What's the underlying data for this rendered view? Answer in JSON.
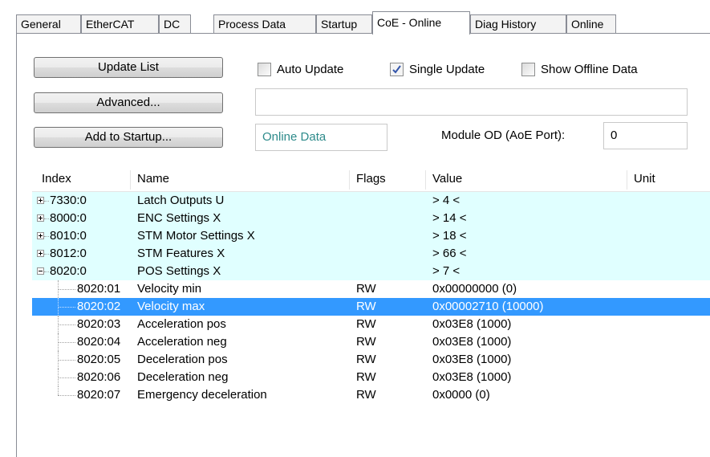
{
  "tabs": [
    "General",
    "EtherCAT",
    "DC",
    "Process Data",
    "Startup",
    "CoE - Online",
    "Diag History",
    "Online"
  ],
  "buttons": {
    "update_list": "Update List",
    "advanced": "Advanced...",
    "add_to_startup": "Add to Startup..."
  },
  "checkboxes": {
    "auto_update": {
      "label": "Auto Update",
      "checked": false
    },
    "single_update": {
      "label": "Single Update",
      "checked": true
    },
    "show_offline": {
      "label": "Show Offline Data",
      "checked": false
    }
  },
  "filter_value": "",
  "online_data_label": "Online Data",
  "module_od_label": "Module OD (AoE Port):",
  "module_od_value": "0",
  "columns": {
    "index": "Index",
    "name": "Name",
    "flags": "Flags",
    "value": "Value",
    "unit": "Unit"
  },
  "rows": [
    {
      "index": "7330:0",
      "name": "Latch Outputs U",
      "flags": "",
      "value": "> 4 <",
      "type": "group",
      "expanded": false
    },
    {
      "index": "8000:0",
      "name": "ENC Settings X",
      "flags": "",
      "value": "> 14 <",
      "type": "group",
      "expanded": false
    },
    {
      "index": "8010:0",
      "name": "STM Motor Settings X",
      "flags": "",
      "value": "> 18 <",
      "type": "group",
      "expanded": false
    },
    {
      "index": "8012:0",
      "name": "STM Features X",
      "flags": "",
      "value": "> 66 <",
      "type": "group",
      "expanded": false
    },
    {
      "index": "8020:0",
      "name": "POS Settings X",
      "flags": "",
      "value": "> 7 <",
      "type": "group",
      "expanded": true
    },
    {
      "index": "8020:01",
      "name": "Velocity min",
      "flags": "RW",
      "value": "0x00000000 (0)",
      "type": "child"
    },
    {
      "index": "8020:02",
      "name": "Velocity max",
      "flags": "RW",
      "value": "0x00002710 (10000)",
      "type": "child",
      "selected": true
    },
    {
      "index": "8020:03",
      "name": "Acceleration pos",
      "flags": "RW",
      "value": "0x03E8 (1000)",
      "type": "child"
    },
    {
      "index": "8020:04",
      "name": "Acceleration neg",
      "flags": "RW",
      "value": "0x03E8 (1000)",
      "type": "child"
    },
    {
      "index": "8020:05",
      "name": "Deceleration pos",
      "flags": "RW",
      "value": "0x03E8 (1000)",
      "type": "child"
    },
    {
      "index": "8020:06",
      "name": "Deceleration neg",
      "flags": "RW",
      "value": "0x03E8 (1000)",
      "type": "child"
    },
    {
      "index": "8020:07",
      "name": "Emergency deceleration",
      "flags": "RW",
      "value": "0x0000 (0)",
      "type": "child"
    }
  ],
  "colors": {
    "group_row": "#e0ffff",
    "selected_row": "#3399ff",
    "online_data_text": "#2e8b8b"
  }
}
